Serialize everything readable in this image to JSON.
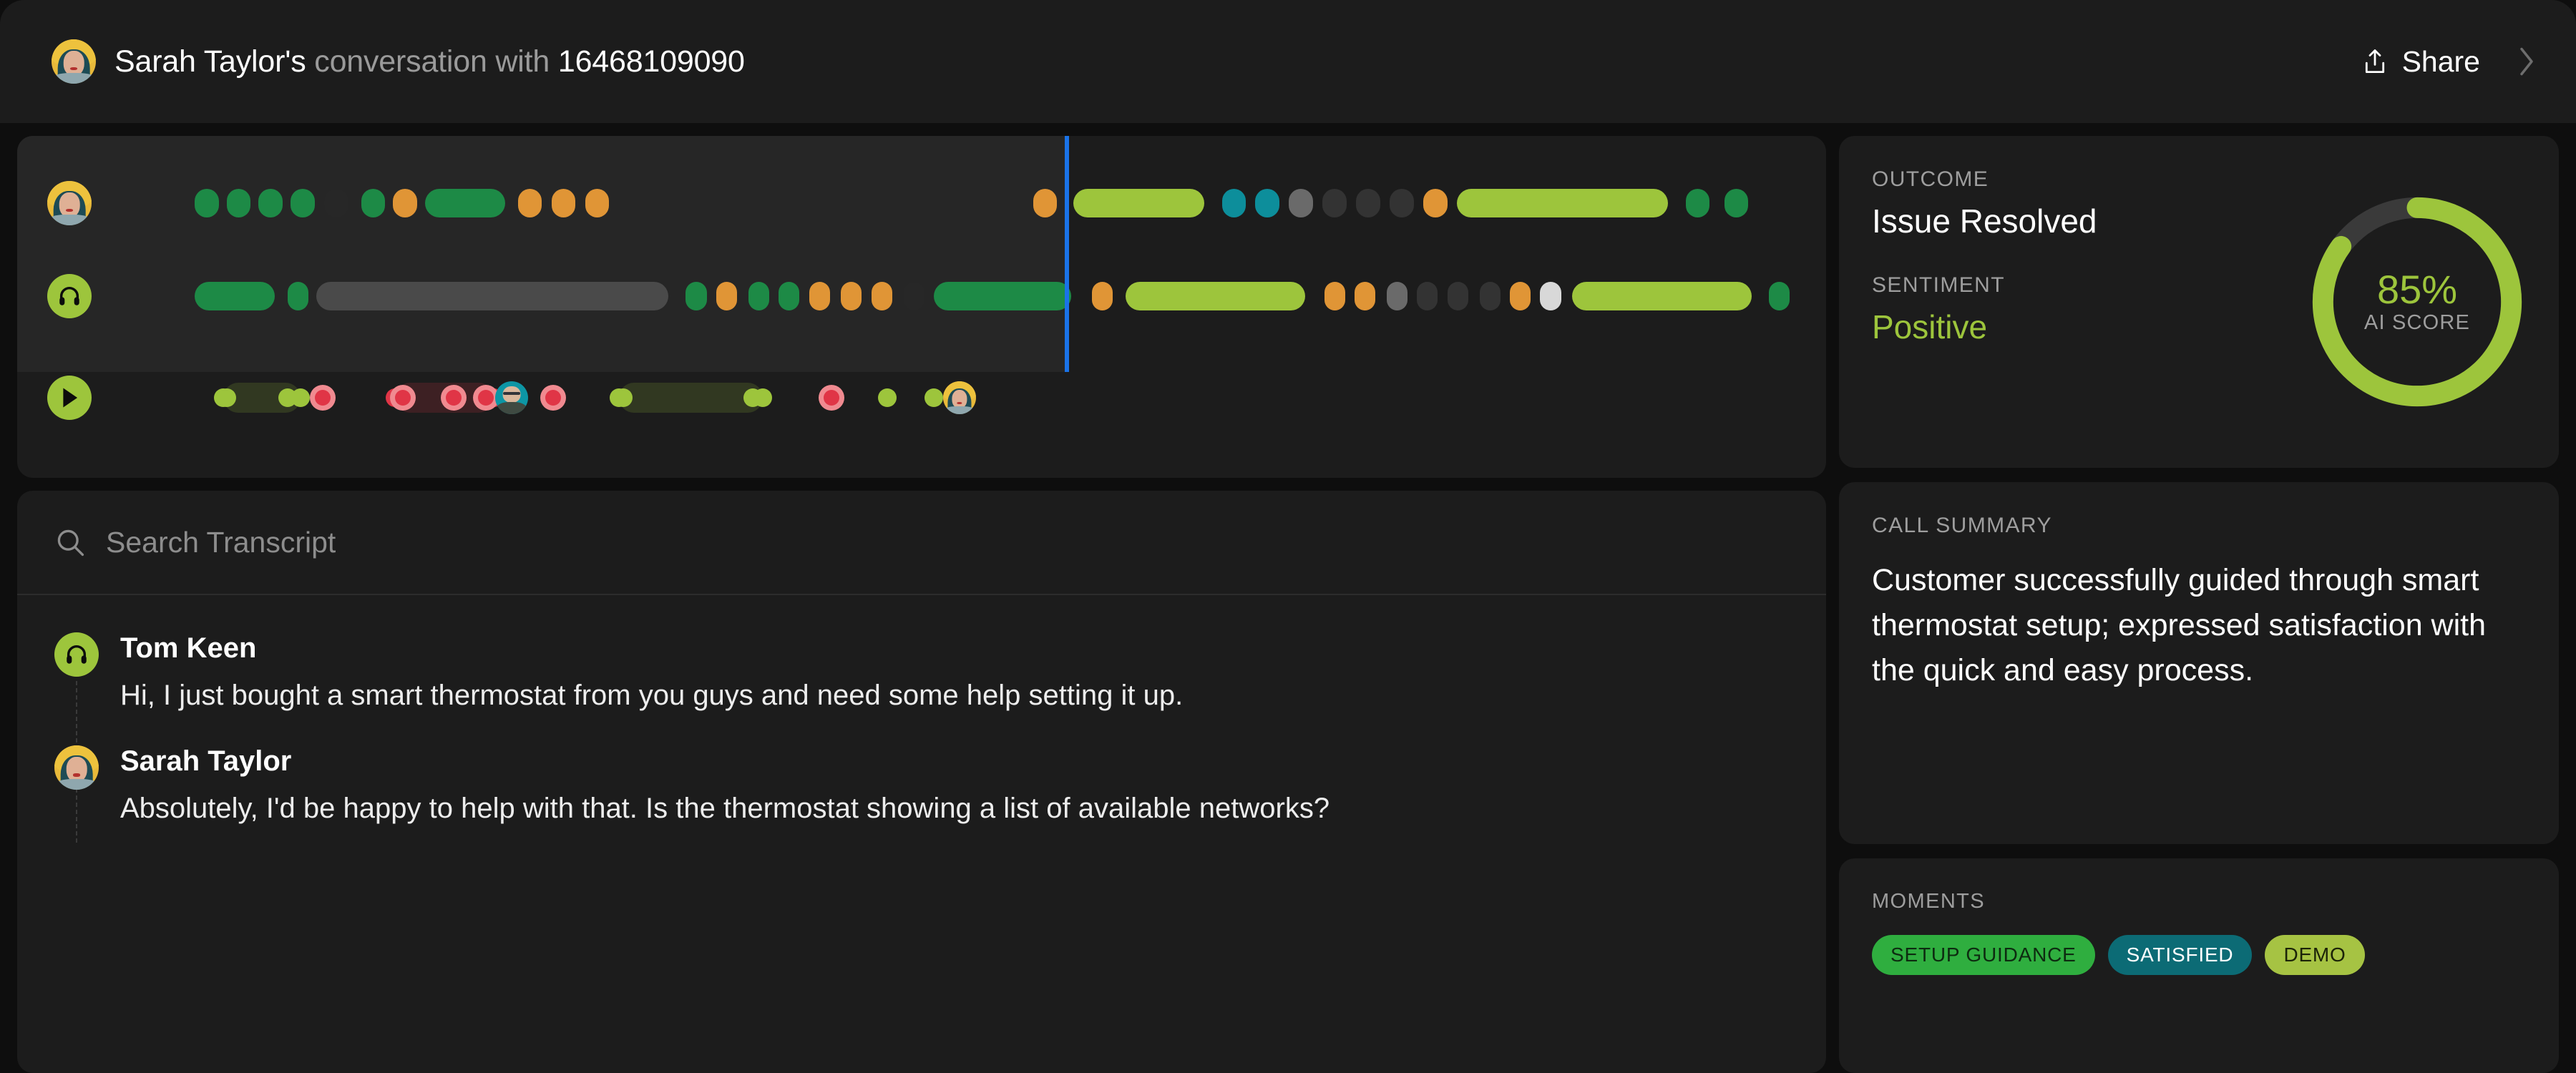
{
  "header": {
    "speaker_name": "Sarah Taylor's",
    "middle_text": " conversation with ",
    "phone_number": "16468109090",
    "share_label": "Share",
    "avatar_name": "Sarah Taylor"
  },
  "timeline": {
    "playhead_percent": 54.4,
    "colors": {
      "green": "#1d8a46",
      "orange": "#e09536",
      "lime": "#9dc53c",
      "teal": "#0d8e9b",
      "gray": "#6a6a6a",
      "dark": "#333333",
      "light": "#d8d8d8",
      "muted_track": "#4a4a4a",
      "empty": "#272727",
      "playhead": "#1a73e8",
      "played_bg": "#262626"
    },
    "rows": [
      {
        "name": "customer-track",
        "badge": "avatar-sarah",
        "segments": [
          {
            "left": 0.0,
            "width": 1.5,
            "color": "green"
          },
          {
            "left": 2.0,
            "width": 1.5,
            "color": "green"
          },
          {
            "left": 4.0,
            "width": 1.5,
            "color": "green"
          },
          {
            "left": 6.0,
            "width": 1.5,
            "color": "green"
          },
          {
            "left": 8.1,
            "width": 1.5,
            "color": "empty"
          },
          {
            "left": 10.4,
            "width": 1.5,
            "color": "green"
          },
          {
            "left": 12.4,
            "width": 1.5,
            "color": "orange"
          },
          {
            "left": 14.4,
            "width": 5.0,
            "color": "green"
          },
          {
            "left": 20.2,
            "width": 1.5,
            "color": "orange"
          },
          {
            "left": 22.3,
            "width": 1.5,
            "color": "orange"
          },
          {
            "left": 24.4,
            "width": 1.5,
            "color": "orange"
          },
          {
            "left": 52.4,
            "width": 1.5,
            "color": "orange"
          },
          {
            "left": 54.9,
            "width": 8.2,
            "color": "lime"
          },
          {
            "left": 64.2,
            "width": 1.5,
            "color": "teal"
          },
          {
            "left": 66.3,
            "width": 1.5,
            "color": "teal"
          },
          {
            "left": 68.4,
            "width": 1.5,
            "color": "gray"
          },
          {
            "left": 70.5,
            "width": 1.5,
            "color": "dark"
          },
          {
            "left": 72.6,
            "width": 1.5,
            "color": "dark"
          },
          {
            "left": 74.7,
            "width": 1.5,
            "color": "dark"
          },
          {
            "left": 76.8,
            "width": 1.5,
            "color": "orange"
          },
          {
            "left": 78.9,
            "width": 13.2,
            "color": "lime"
          },
          {
            "left": 93.2,
            "width": 1.5,
            "color": "green"
          },
          {
            "left": 95.6,
            "width": 1.5,
            "color": "green"
          }
        ]
      },
      {
        "name": "agent-track",
        "badge": "headphones",
        "segments": [
          {
            "left": 0.0,
            "width": 5.0,
            "color": "green"
          },
          {
            "left": 5.8,
            "width": 1.3,
            "color": "green"
          },
          {
            "left": 7.6,
            "width": 22.0,
            "color": "muted_track"
          },
          {
            "left": 30.7,
            "width": 1.3,
            "color": "green"
          },
          {
            "left": 32.6,
            "width": 1.3,
            "color": "orange"
          },
          {
            "left": 34.6,
            "width": 1.3,
            "color": "green"
          },
          {
            "left": 36.5,
            "width": 1.3,
            "color": "green"
          },
          {
            "left": 38.4,
            "width": 1.3,
            "color": "orange"
          },
          {
            "left": 40.4,
            "width": 1.3,
            "color": "orange"
          },
          {
            "left": 42.3,
            "width": 1.3,
            "color": "orange"
          },
          {
            "left": 44.3,
            "width": 1.3,
            "color": "empty"
          },
          {
            "left": 46.2,
            "width": 8.6,
            "color": "green"
          },
          {
            "left": 56.1,
            "width": 1.3,
            "color": "orange"
          },
          {
            "left": 58.2,
            "width": 11.2,
            "color": "lime"
          },
          {
            "left": 70.6,
            "width": 1.3,
            "color": "orange"
          },
          {
            "left": 72.5,
            "width": 1.3,
            "color": "orange"
          },
          {
            "left": 74.5,
            "width": 1.3,
            "color": "gray"
          },
          {
            "left": 76.4,
            "width": 1.3,
            "color": "dark"
          },
          {
            "left": 78.3,
            "width": 1.3,
            "color": "dark"
          },
          {
            "left": 80.3,
            "width": 1.3,
            "color": "dark"
          },
          {
            "left": 82.2,
            "width": 1.3,
            "color": "orange"
          },
          {
            "left": 84.1,
            "width": 1.3,
            "color": "light"
          },
          {
            "left": 86.1,
            "width": 11.2,
            "color": "lime"
          },
          {
            "left": 98.4,
            "width": 1.3,
            "color": "green"
          }
        ]
      }
    ],
    "moments_track": {
      "name": "moments-track",
      "badge": "play",
      "bars": [
        {
          "left": 1.8,
          "width": 4.8,
          "color": "lime"
        },
        {
          "left": 12.5,
          "width": 6.2,
          "color": "red"
        },
        {
          "left": 26.5,
          "width": 9.0,
          "color": "lime"
        }
      ],
      "dots": [
        {
          "left": 2.0,
          "color": "lime"
        },
        {
          "left": 5.8,
          "color": "lime"
        },
        {
          "left": 26.8,
          "color": "lime"
        },
        {
          "left": 34.9,
          "color": "lime"
        },
        {
          "left": 43.3,
          "color": "lime"
        },
        {
          "left": 46.2,
          "color": "lime"
        }
      ],
      "rings": [
        {
          "left": 8.0,
          "color": "red"
        },
        {
          "left": 13.0,
          "color": "red"
        },
        {
          "left": 18.2,
          "color": "red"
        },
        {
          "left": 16.2,
          "color": "red"
        },
        {
          "left": 22.4,
          "color": "red"
        },
        {
          "left": 39.8,
          "color": "red"
        }
      ],
      "avatars": [
        {
          "left": 19.8,
          "who": "tom"
        },
        {
          "left": 47.8,
          "who": "sarah"
        }
      ],
      "red": "#e03546",
      "red_ring": "#f08a90",
      "lime": "#9dc53c"
    }
  },
  "search": {
    "placeholder": "Search Transcript",
    "value": ""
  },
  "transcript": {
    "messages": [
      {
        "name": "Tom Keen",
        "avatar": "headphones",
        "text": "Hi, I just bought a smart thermostat from you guys and need some help setting it up."
      },
      {
        "name": "Sarah Taylor",
        "avatar": "sarah",
        "text": "Absolutely, I'd be happy to help with that. Is the thermostat showing a list of available networks?"
      }
    ]
  },
  "sidebar": {
    "outcome": {
      "kicker": "OUTCOME",
      "value": "Issue Resolved"
    },
    "sentiment": {
      "kicker": "SENTIMENT",
      "value": "Positive",
      "color": "#9dc53c"
    },
    "ai_score": {
      "percent": "85%",
      "value": 85,
      "label": "AI SCORE",
      "arc_color": "#9dc53c",
      "track_color": "#3a3a3a"
    },
    "summary": {
      "kicker": "CALL SUMMARY",
      "text": "Customer successfully guided through smart thermostat setup; expressed satisfaction with the quick and easy process."
    },
    "moments": {
      "kicker": "MOMENTS",
      "chips": [
        {
          "label": "SETUP GUIDANCE",
          "bg": "#2fae3f",
          "fg": "#0d2b10"
        },
        {
          "label": "SATISFIED",
          "bg": "#0c6b75",
          "fg": "#ffffff"
        },
        {
          "label": "DEMO",
          "bg": "#a6c343",
          "fg": "#1b2308"
        }
      ]
    }
  }
}
